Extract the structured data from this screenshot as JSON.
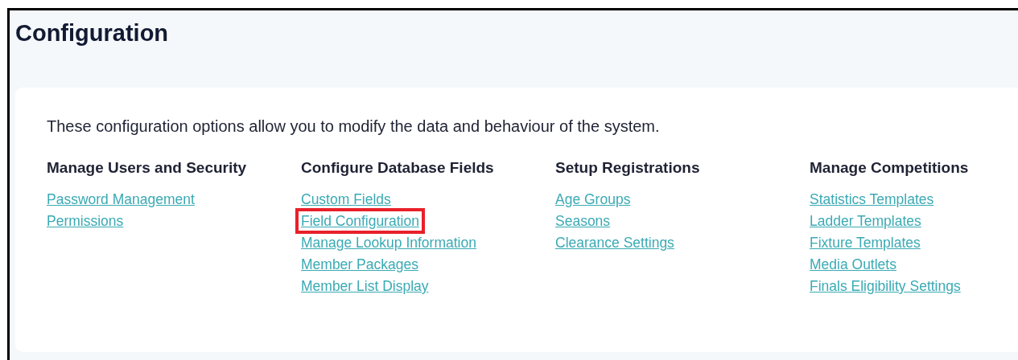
{
  "page_title": "Configuration",
  "intro": "These configuration options allow you to modify the data and behaviour of the system.",
  "sections": [
    {
      "heading": "Manage Users and Security",
      "links": [
        {
          "label": "Password Management",
          "highlighted": false
        },
        {
          "label": "Permissions",
          "highlighted": false
        }
      ]
    },
    {
      "heading": "Configure Database Fields",
      "links": [
        {
          "label": "Custom Fields",
          "highlighted": false
        },
        {
          "label": "Field Configuration",
          "highlighted": true
        },
        {
          "label": "Manage Lookup Information",
          "highlighted": false
        },
        {
          "label": "Member Packages",
          "highlighted": false
        },
        {
          "label": "Member List Display",
          "highlighted": false
        }
      ]
    },
    {
      "heading": "Setup Registrations",
      "links": [
        {
          "label": "Age Groups",
          "highlighted": false
        },
        {
          "label": "Seasons",
          "highlighted": false
        },
        {
          "label": "Clearance Settings",
          "highlighted": false
        }
      ]
    },
    {
      "heading": "Manage Competitions",
      "links": [
        {
          "label": "Statistics Templates",
          "highlighted": false
        },
        {
          "label": "Ladder Templates",
          "highlighted": false
        },
        {
          "label": "Fixture Templates",
          "highlighted": false
        },
        {
          "label": "Media Outlets",
          "highlighted": false
        },
        {
          "label": "Finals Eligibility Settings",
          "highlighted": false
        }
      ]
    }
  ]
}
